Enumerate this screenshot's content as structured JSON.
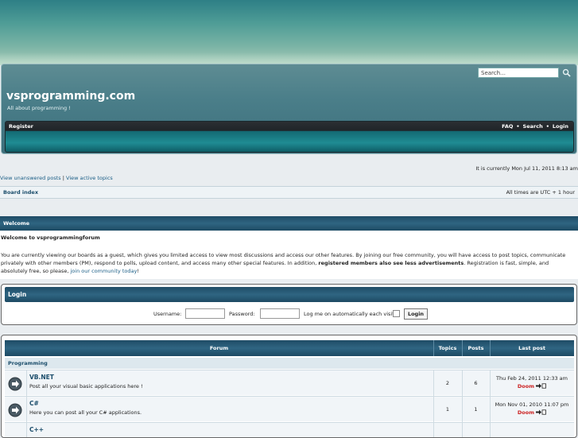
{
  "site": {
    "title": "vsprogramming.com",
    "description": "All about programming !"
  },
  "search": {
    "placeholder": "Search…"
  },
  "nav": {
    "register": "Register",
    "faq": "FAQ",
    "search": "Search",
    "login": "Login",
    "separator": "•"
  },
  "info": {
    "current_time": "It is currently Mon Jul 11, 2011 8:13 am",
    "unanswered": "View unanswered posts",
    "active": "View active topics",
    "divider": "|",
    "board_index": "Board index",
    "timezone": "All times are UTC + 1 hour"
  },
  "welcome": {
    "header": "Welcome",
    "title": "Welcome to vsprogrammingforum",
    "text_part1": "You are currently viewing our boards as a guest, which gives you limited access to view most discussions and access our other features. By joining our free community, you will have access to post topics, communicate privately with other members (PM), respond to polls, upload content, and access many other special features. In addition, ",
    "text_bold": "registered members also see less advertisements",
    "text_part2": ". Registration is fast, simple, and absolutely free, so please, ",
    "text_link": "join our community today",
    "text_end": "!"
  },
  "login": {
    "header": "Login",
    "username_label": "Username:",
    "password_label": "Password:",
    "remember_label": "Log me on automatically each visit",
    "button": "Login"
  },
  "forum": {
    "columns": {
      "forum": "Forum",
      "topics": "Topics",
      "posts": "Posts",
      "last_post": "Last post"
    },
    "category": "Programming",
    "rows": [
      {
        "name": "VB.NET",
        "desc": "Post all your visual basic applications here !",
        "topics": "2",
        "posts": "6",
        "last_date": "Thu Feb 24, 2011 12:33 am",
        "last_author": "Doom"
      },
      {
        "name": "C#",
        "desc": "Here you can post all your C# applications.",
        "topics": "1",
        "posts": "1",
        "last_date": "Mon Nov 01, 2010 11:07 pm",
        "last_author": "Doom"
      },
      {
        "name": "C++",
        "desc": "",
        "topics": "",
        "posts": "",
        "last_date": "",
        "last_author": ""
      }
    ]
  }
}
